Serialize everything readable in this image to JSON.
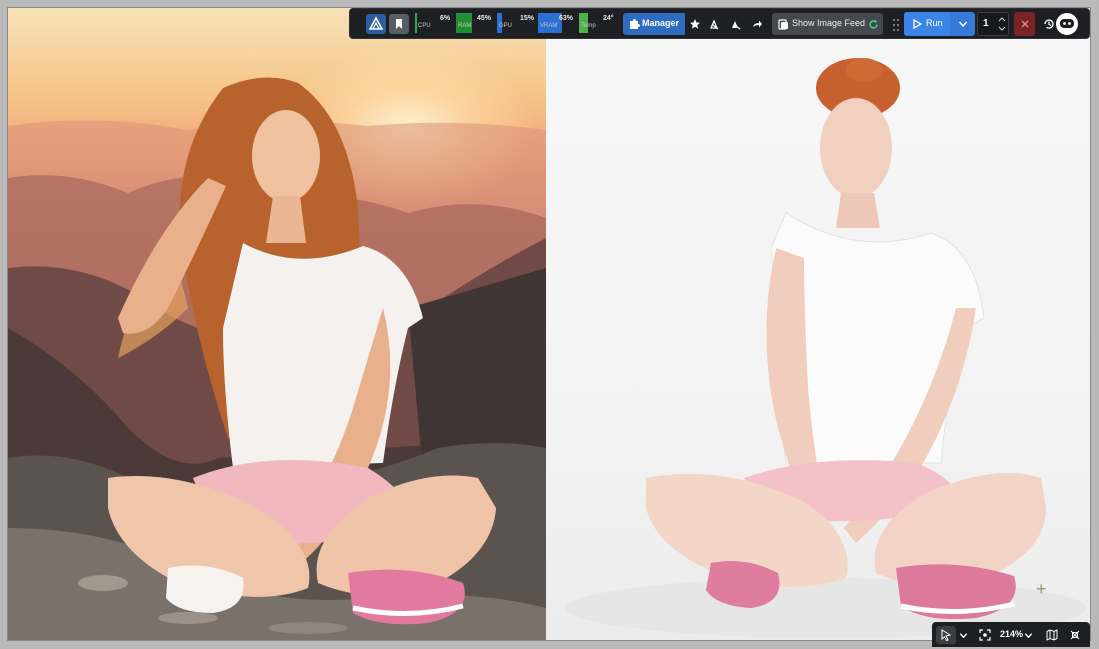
{
  "toolbar": {
    "meters": [
      {
        "label": "CPU",
        "value": "6%",
        "percent": 6,
        "color": "#2fa84f"
      },
      {
        "label": "RAM",
        "value": "45%",
        "percent": 45,
        "color": "#1f8f35"
      },
      {
        "label": "GPU",
        "value": "15%",
        "percent": 15,
        "color": "#2a6fd1"
      },
      {
        "label": "VRAM",
        "value": "63%",
        "percent": 63,
        "color": "#2a6fd1"
      },
      {
        "label": "Temp",
        "value": "24°",
        "percent": 24,
        "color": "#49b34a"
      }
    ],
    "manager_label": "Manager",
    "show_feed_label": "Show Image Feed",
    "run_label": "Run",
    "queue_count": "1"
  },
  "zoom": {
    "level": "214%"
  },
  "colors": {
    "accent_blue": "#3a86e8",
    "manager_blue": "#2d6cc0",
    "cancel_red": "#7a2525",
    "toolbar_bg": "#1d1f22"
  },
  "icons": [
    "logo-icon",
    "bookmark-icon",
    "puzzle-icon",
    "star-icon",
    "eraser-icon",
    "eraser-alt-icon",
    "share-icon",
    "feed-icon",
    "refresh-icon",
    "play-icon",
    "chevron-down-icon",
    "stepper-up-icon",
    "stepper-down-icon",
    "close-icon",
    "drag-handle-icon",
    "history-icon",
    "assistant-icon",
    "pointer-icon",
    "fit-icon",
    "map-icon",
    "link-off-icon"
  ]
}
